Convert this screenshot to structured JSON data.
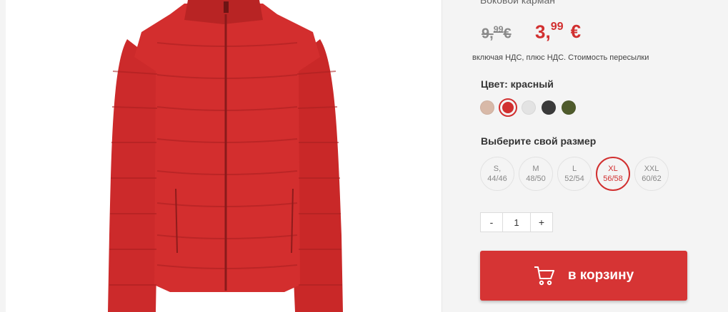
{
  "product": {
    "partial_feature_text": "Боковой карман",
    "image_icon": "red-puffer-jacket-image"
  },
  "price": {
    "old_main": "9,",
    "old_cents": "99",
    "old_currency": "€",
    "new_main": "3,",
    "new_cents": "99",
    "new_currency": "€",
    "vat_note": "включая НДС, плюс НДС. Стоимость пересылки"
  },
  "color": {
    "label": "Цвет: красный",
    "swatches": [
      {
        "name": "beige",
        "hex": "#d8b9a8"
      },
      {
        "name": "red",
        "hex": "#d12f2f",
        "selected": true
      },
      {
        "name": "light-grey",
        "hex": "#e3e3e3"
      },
      {
        "name": "dark-grey",
        "hex": "#3a3a3a"
      },
      {
        "name": "olive",
        "hex": "#4f5b2c"
      }
    ]
  },
  "size": {
    "label": "Выберите свой размер",
    "options": [
      {
        "top": "S,",
        "bottom": "44/46"
      },
      {
        "top": "M",
        "bottom": "48/50"
      },
      {
        "top": "L",
        "bottom": "52/54"
      },
      {
        "top": "XL",
        "bottom": "56/58",
        "selected": true
      },
      {
        "top": "XXL",
        "bottom": "60/62"
      }
    ]
  },
  "quantity": {
    "minus": "-",
    "value": "1",
    "plus": "+"
  },
  "cart": {
    "label": "в корзину",
    "icon": "cart-icon"
  },
  "colors": {
    "accent": "#d12f2f",
    "button": "#d63434"
  }
}
